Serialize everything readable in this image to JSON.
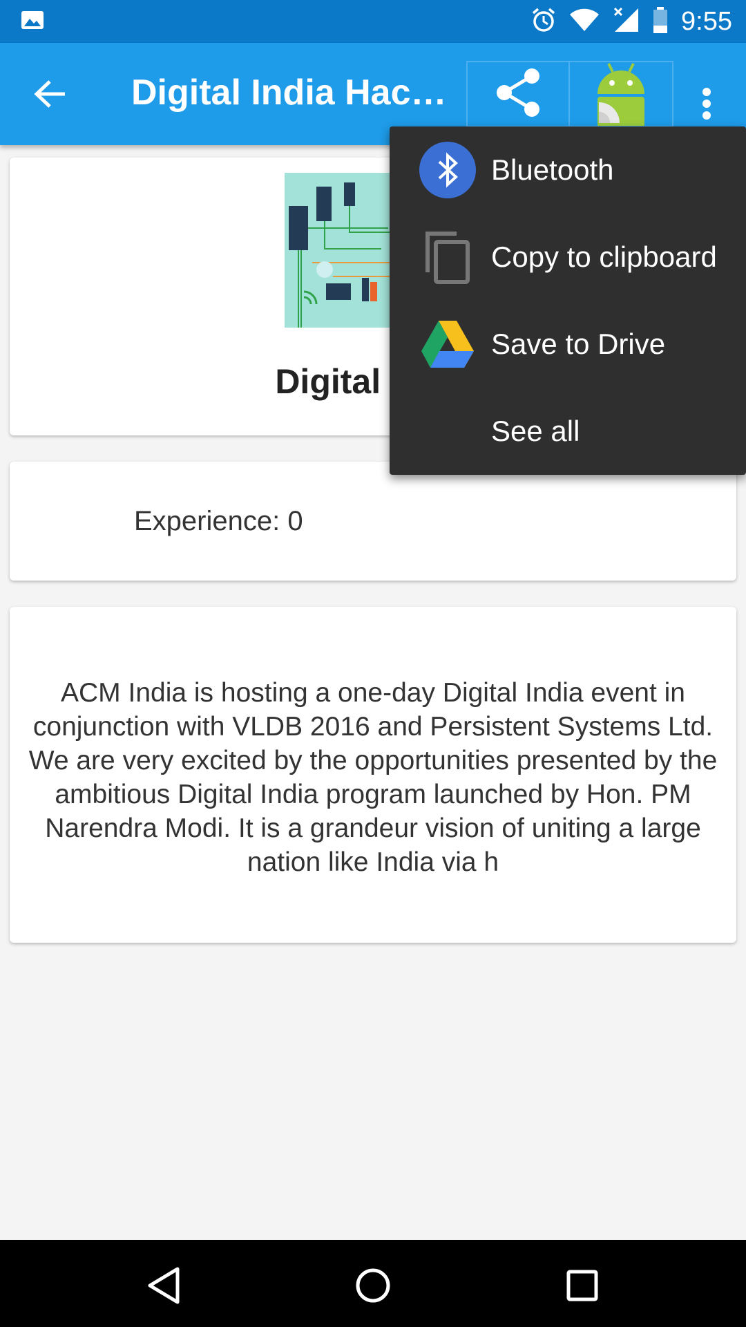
{
  "status_bar": {
    "time": "9:55",
    "icons": [
      "gallery-icon",
      "alarm-icon",
      "wifi-icon",
      "signal-icon",
      "battery-icon"
    ]
  },
  "app_bar": {
    "title": "Digital India Hack…",
    "back_icon": "arrow-left-icon",
    "share_icon": "share-icon",
    "share_app_icon": "android-icon",
    "overflow_icon": "more-vert-icon"
  },
  "event": {
    "title": "Digital India",
    "experience": "Experience: 0",
    "description": "ACM India is hosting a one-day Digital India event in conjunction with VLDB 2016 and Persistent Systems Ltd. We are very excited by the opportunities presented by the ambitious Digital India program launched by Hon. PM Narendra Modi. It is a grandeur vision of uniting a large nation like India via h"
  },
  "share_menu": {
    "items": [
      {
        "label": "Bluetooth",
        "icon": "bluetooth-icon"
      },
      {
        "label": "Copy to clipboard",
        "icon": "copy-icon"
      },
      {
        "label": "Save to Drive",
        "icon": "google-drive-icon"
      },
      {
        "label": "See all",
        "icon": ""
      }
    ]
  },
  "colors": {
    "status_bar": "#0b79c8",
    "app_bar": "#1e9be9",
    "popup": "#2f2f2f",
    "bluetooth": "#3b6fd4"
  }
}
